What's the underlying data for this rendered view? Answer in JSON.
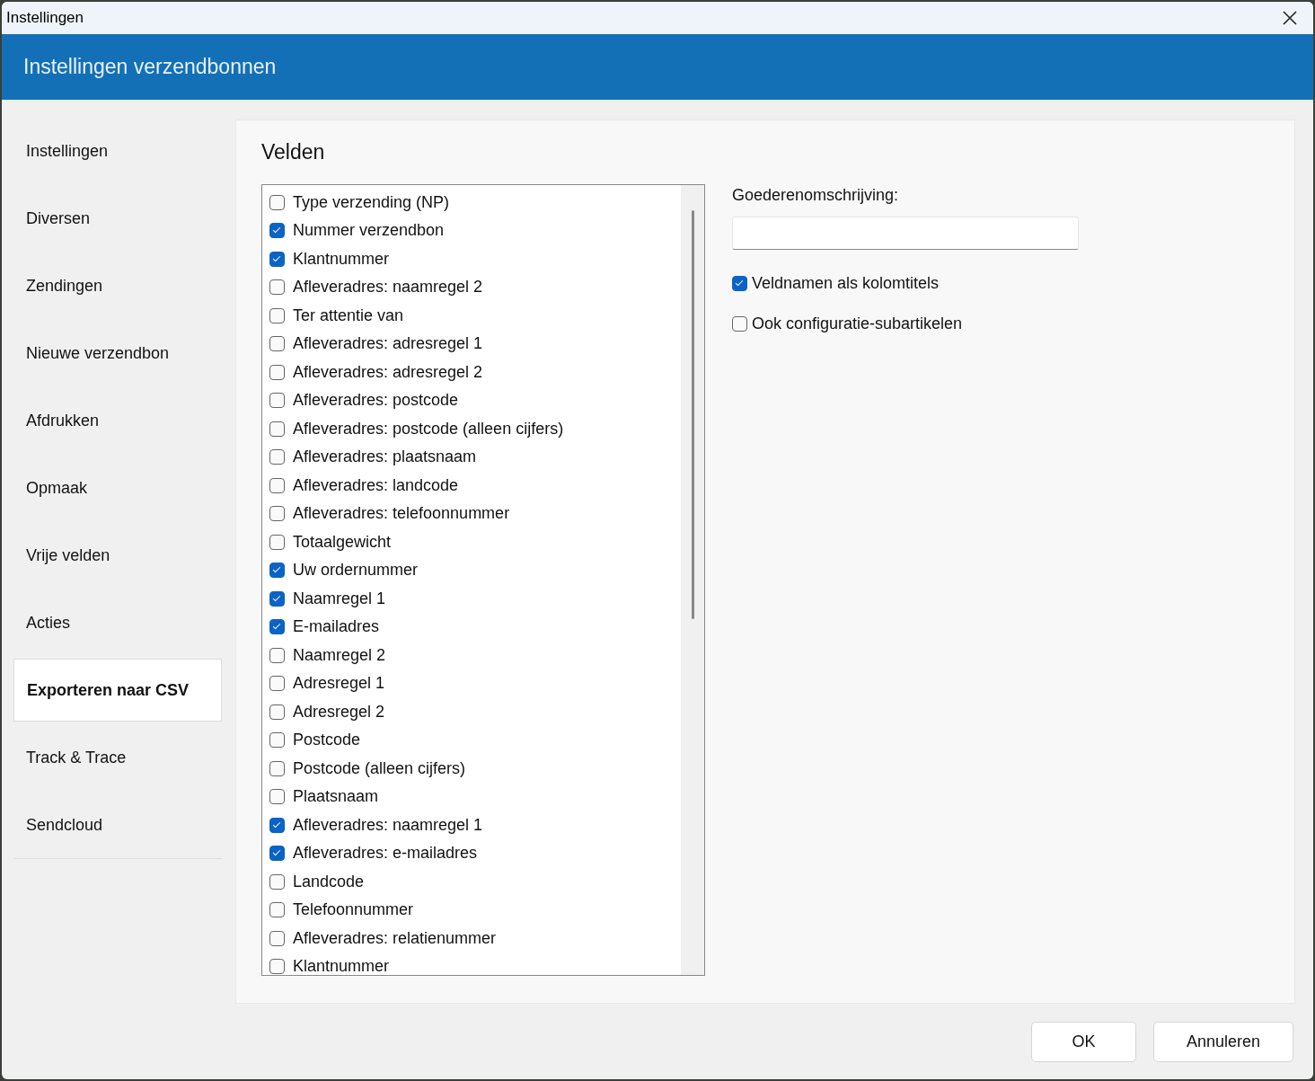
{
  "window": {
    "title": "Instellingen"
  },
  "header": {
    "title": "Instellingen verzendbonnen"
  },
  "sidebar": {
    "items": [
      {
        "label": "Instellingen",
        "selected": false
      },
      {
        "label": "Diversen",
        "selected": false
      },
      {
        "label": "Zendingen",
        "selected": false
      },
      {
        "label": "Nieuwe verzendbon",
        "selected": false
      },
      {
        "label": "Afdrukken",
        "selected": false
      },
      {
        "label": "Opmaak",
        "selected": false
      },
      {
        "label": "Vrije velden",
        "selected": false
      },
      {
        "label": "Acties",
        "selected": false
      },
      {
        "label": "Exporteren naar CSV",
        "selected": true
      },
      {
        "label": "Track & Trace",
        "selected": false
      },
      {
        "label": "Sendcloud",
        "selected": false
      }
    ]
  },
  "section": {
    "title": "Velden"
  },
  "fields": [
    {
      "label": "Type verzending (NP)",
      "checked": false
    },
    {
      "label": "Nummer verzendbon",
      "checked": true
    },
    {
      "label": "Klantnummer",
      "checked": true
    },
    {
      "label": "Afleveradres: naamregel 2",
      "checked": false
    },
    {
      "label": "Ter attentie van",
      "checked": false
    },
    {
      "label": "Afleveradres: adresregel 1",
      "checked": false
    },
    {
      "label": "Afleveradres: adresregel 2",
      "checked": false
    },
    {
      "label": "Afleveradres: postcode",
      "checked": false
    },
    {
      "label": "Afleveradres: postcode (alleen cijfers)",
      "checked": false
    },
    {
      "label": "Afleveradres: plaatsnaam",
      "checked": false
    },
    {
      "label": "Afleveradres: landcode",
      "checked": false
    },
    {
      "label": "Afleveradres: telefoonnummer",
      "checked": false
    },
    {
      "label": "Totaalgewicht",
      "checked": false
    },
    {
      "label": "Uw ordernummer",
      "checked": true
    },
    {
      "label": "Naamregel 1",
      "checked": true
    },
    {
      "label": "E-mailadres",
      "checked": true
    },
    {
      "label": "Naamregel 2",
      "checked": false
    },
    {
      "label": "Adresregel 1",
      "checked": false
    },
    {
      "label": "Adresregel 2",
      "checked": false
    },
    {
      "label": "Postcode",
      "checked": false
    },
    {
      "label": "Postcode (alleen cijfers)",
      "checked": false
    },
    {
      "label": "Plaatsnaam",
      "checked": false
    },
    {
      "label": "Afleveradres: naamregel 1",
      "checked": true
    },
    {
      "label": "Afleveradres: e-mailadres",
      "checked": true
    },
    {
      "label": "Landcode",
      "checked": false
    },
    {
      "label": "Telefoonnummer",
      "checked": false
    },
    {
      "label": "Afleveradres: relatienummer",
      "checked": false
    },
    {
      "label": "Klantnummer",
      "checked": false
    }
  ],
  "description": {
    "label": "Goederenomschrijving:"
  },
  "options": [
    {
      "label": "Veldnamen als kolomtitels",
      "checked": true
    },
    {
      "label": "Ook configuratie-subartikelen",
      "checked": false
    }
  ],
  "buttons": [
    "OK",
    "Annuleren"
  ]
}
